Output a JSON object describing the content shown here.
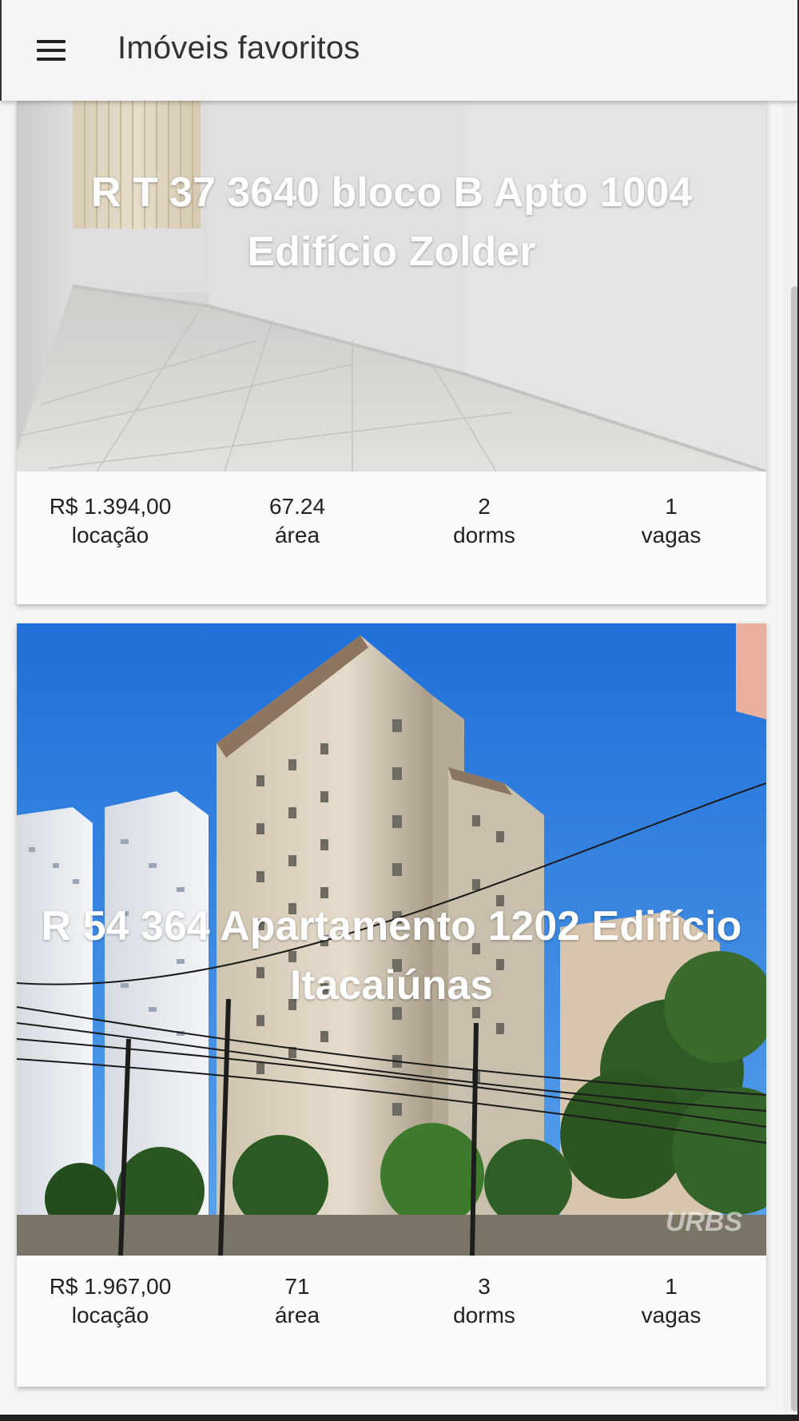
{
  "header": {
    "title": "Imóveis favoritos",
    "menu_icon": "hamburger-menu-icon"
  },
  "colors": {
    "appbar": "#f5f5f5",
    "card": "#fafafa",
    "title_text": "#ffffff"
  },
  "listings": [
    {
      "title": "R T 37 3640 bloco B Apto 1004 Edifício Zolder",
      "price": "R$ 1.394,00",
      "price_label": "locação",
      "area": "67.24",
      "area_label": "área",
      "dorms": "2",
      "dorms_label": "dorms",
      "vagas": "1",
      "vagas_label": "vagas"
    },
    {
      "title": "R 54 364 Apartamento 1202 Edifício Itacaiúnas",
      "price": "R$ 1.967,00",
      "price_label": "locação",
      "area": "71",
      "area_label": "área",
      "dorms": "3",
      "dorms_label": "dorms",
      "vagas": "1",
      "vagas_label": "vagas",
      "watermark": "URBS"
    }
  ]
}
